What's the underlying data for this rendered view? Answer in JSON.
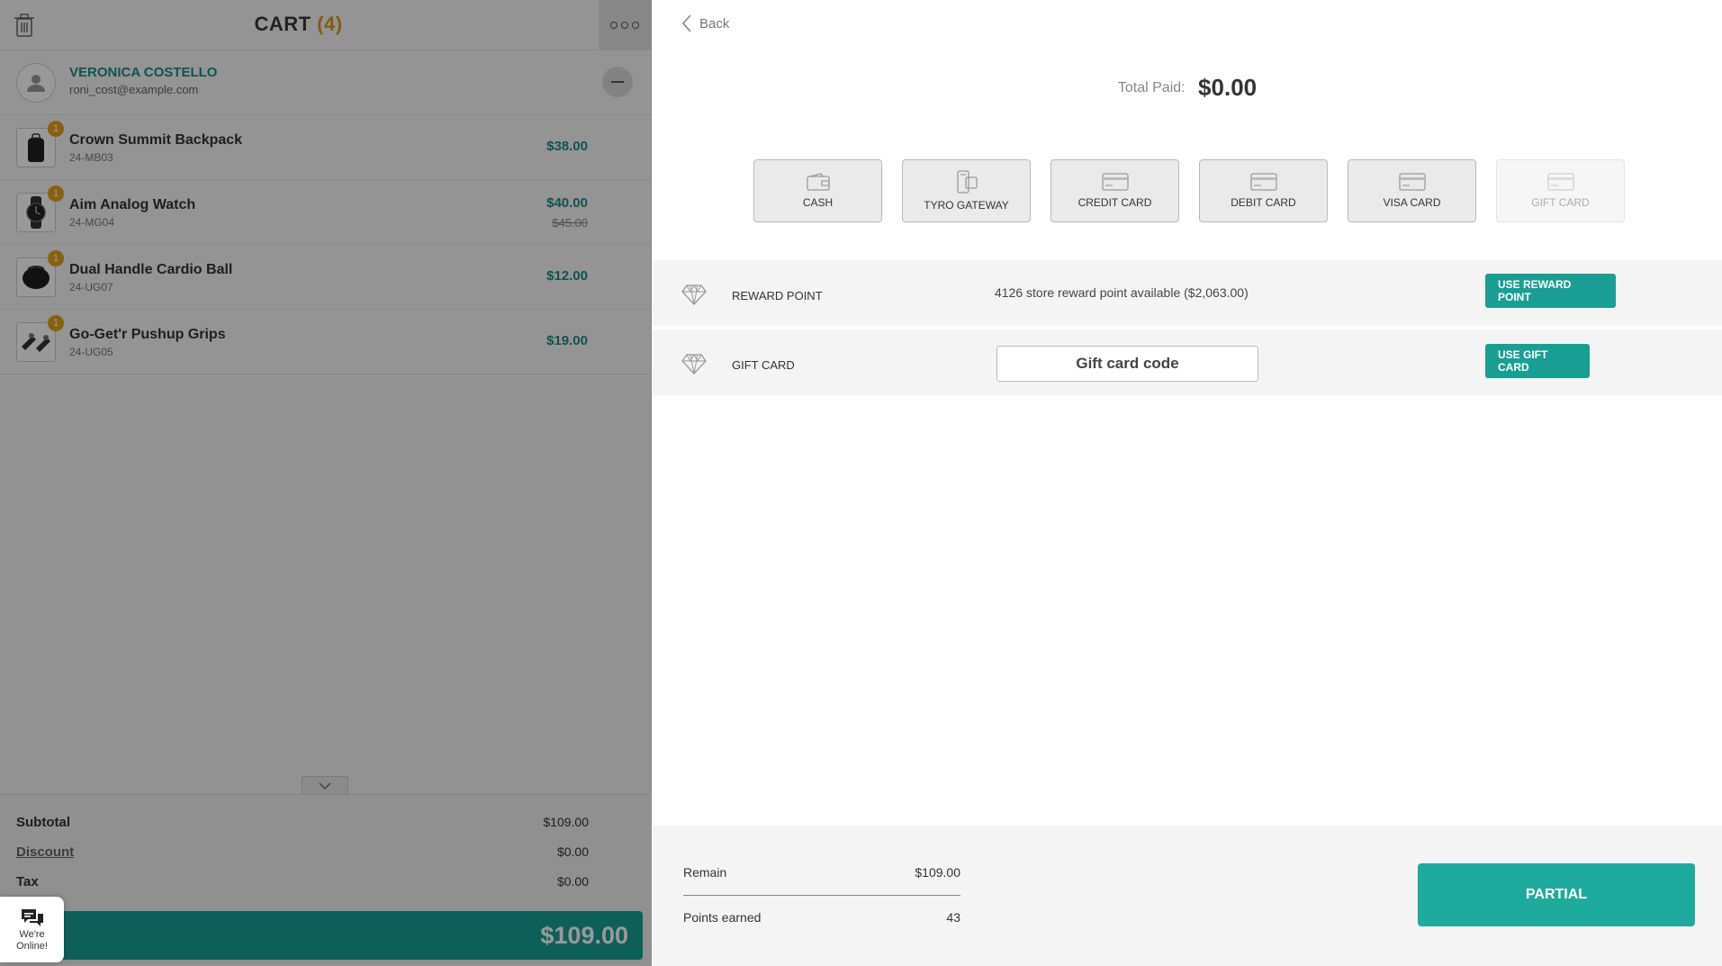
{
  "cart": {
    "title": "CART",
    "count": "(4)",
    "customer": {
      "name": "VERONICA COSTELLO",
      "email": "roni_cost@example.com"
    },
    "items": [
      {
        "qty": "1",
        "name": "Crown Summit Backpack",
        "sku": "24-MB03",
        "price": "$38.00",
        "old_price": ""
      },
      {
        "qty": "1",
        "name": "Aim Analog Watch",
        "sku": "24-MG04",
        "price": "$40.00",
        "old_price": "$45.00"
      },
      {
        "qty": "1",
        "name": "Dual Handle Cardio Ball",
        "sku": "24-UG07",
        "price": "$12.00",
        "old_price": ""
      },
      {
        "qty": "1",
        "name": "Go-Get'r Pushup Grips",
        "sku": "24-UG05",
        "price": "$19.00",
        "old_price": ""
      }
    ],
    "totals": {
      "subtotal_label": "Subtotal",
      "subtotal": "$109.00",
      "discount_label": "Discount",
      "discount": "$0.00",
      "tax_label": "Tax",
      "tax": "$0.00",
      "grand_total": "$109.00"
    }
  },
  "chat": {
    "label": "We're Online!"
  },
  "payment": {
    "back_label": "Back",
    "total_paid_label": "Total Paid:",
    "total_paid": "$0.00",
    "methods": [
      {
        "label": "CASH",
        "icon": "wallet-icon",
        "enabled": true
      },
      {
        "label": "TYRO GATEWAY",
        "icon": "terminal-icon",
        "enabled": true
      },
      {
        "label": "CREDIT CARD",
        "icon": "card-icon",
        "enabled": true
      },
      {
        "label": "DEBIT CARD",
        "icon": "card-icon",
        "enabled": true
      },
      {
        "label": "VISA CARD",
        "icon": "card-icon",
        "enabled": true
      },
      {
        "label": "GIFT CARD",
        "icon": "card-icon",
        "enabled": false
      }
    ],
    "reward": {
      "label": "REWARD POINT",
      "info": "4126 store reward point available ($2,063.00)",
      "button": "USE REWARD POINT"
    },
    "giftcard": {
      "label": "GIFT CARD",
      "placeholder": "Gift card code",
      "button": "USE GIFT CARD"
    },
    "footer": {
      "remain_label": "Remain",
      "remain": "$109.00",
      "points_label": "Points earned",
      "points": "43",
      "partial_button": "PARTIAL"
    }
  },
  "colors": {
    "accent": "#1a9e94",
    "badge": "#e3a21a",
    "brand_text": "#1c8b83"
  }
}
